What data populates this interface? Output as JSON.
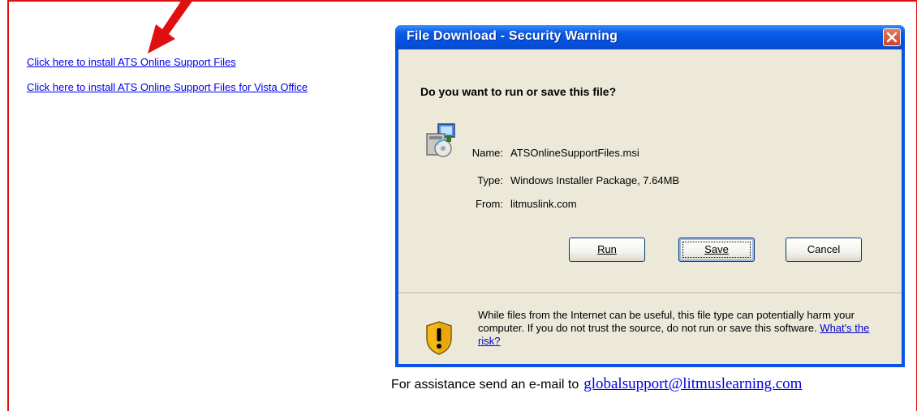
{
  "page": {
    "link1": "Click here to install ATS Online Support Files",
    "link2": "Click here to install ATS Online Support Files for Vista Office",
    "assist_prefix": "For assistance send an e-mail to",
    "assist_email": "globalsupport@litmuslearning.com"
  },
  "dialog": {
    "title": "File Download - Security Warning",
    "question": "Do you want to run or save this file?",
    "name_label": "Name:",
    "name_value": "ATSOnlineSupportFiles.msi",
    "type_label": "Type:",
    "type_value": "Windows Installer Package, 7.64MB",
    "from_label": "From:",
    "from_value": "litmuslink.com",
    "run_label": "Run",
    "save_label": "Save",
    "cancel_label": "Cancel",
    "warning_text": "While files from the Internet can be useful, this file type can potentially harm your computer. If you do not trust the source, do not run or save this software.",
    "risk_link": "What's the risk?"
  },
  "colors": {
    "frame": "#e01010",
    "arrow": "#e01010",
    "titlebar": "#0a5de8",
    "dialog_bg": "#ece9d8",
    "link": "#0000ee"
  },
  "icons": [
    "red-arrow-annotation",
    "close-icon",
    "installer-package-icon",
    "security-shield-icon"
  ]
}
